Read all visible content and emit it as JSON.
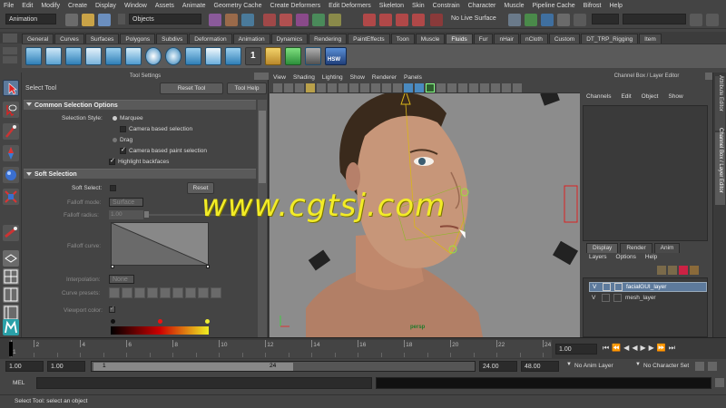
{
  "menubar": [
    "File",
    "Edit",
    "Modify",
    "Create",
    "Display",
    "Window",
    "Assets",
    "Animate",
    "Geometry Cache",
    "Create Deformers",
    "Edit Deformers",
    "Skeleton",
    "Skin",
    "Constrain",
    "Character",
    "Muscle",
    "Pipeline Cache",
    "Bifrost",
    "Help"
  ],
  "statusline": {
    "mode": "Animation",
    "objects": "Objects",
    "live": "No Live Surface"
  },
  "shelf_tabs": [
    "General",
    "Curves",
    "Surfaces",
    "Polygons",
    "Subdivs",
    "Deformation",
    "Animation",
    "Dynamics",
    "Rendering",
    "PaintEffects",
    "Toon",
    "Muscle",
    "Fluids",
    "Fur",
    "nHair",
    "nCloth",
    "Custom",
    "DT_TRP_Rigging",
    "Item"
  ],
  "shelf_active": "Fluids",
  "shelf_hsw": "HSW",
  "shelf_one": "1",
  "tool_settings": {
    "header": "Tool Settings",
    "title": "Select Tool",
    "reset_tool": "Reset Tool",
    "tool_help": "Tool Help",
    "sec_common": "Common Selection Options",
    "selection_style": "Selection Style:",
    "marquee": "Marquee",
    "camera_based_selection": "Camera based selection",
    "drag": "Drag",
    "camera_based_paint": "Camera based paint selection",
    "highlight_backfaces": "Highlight backfaces",
    "sec_soft": "Soft Selection",
    "soft_select": "Soft Select:",
    "reset": "Reset",
    "falloff_mode": "Falloff mode:",
    "falloff_mode_val": "Surface",
    "falloff_radius": "Falloff radius:",
    "falloff_radius_val": "1.00",
    "falloff_curve": "Falloff curve:",
    "interpolation": "Interpolation:",
    "interpolation_val": "None",
    "curve_presets": "Curve presets:",
    "viewport_color": "Viewport color:"
  },
  "viewport": {
    "menu": [
      "View",
      "Shading",
      "Lighting",
      "Show",
      "Renderer",
      "Panels"
    ],
    "camera": "persp",
    "watermark": "www.cgtsj.com"
  },
  "channel_box": {
    "title": "Channel Box / Layer Editor",
    "menu": [
      "Channels",
      "Edit",
      "Object",
      "Show"
    ],
    "side_tab1": "Attribute Editor",
    "side_tab2": "Channel Box / Layer Editor",
    "layer_tabs": [
      "Display",
      "Render",
      "Anim"
    ],
    "layer_menu": [
      "Layers",
      "Options",
      "Help"
    ],
    "layers": [
      {
        "v": "V",
        "name": "facialGUI_layer"
      },
      {
        "v": "V",
        "name": "mesh_layer"
      }
    ]
  },
  "timeline": {
    "ticks": [
      "1",
      "2",
      "4",
      "6",
      "8",
      "10",
      "12",
      "14",
      "16",
      "18",
      "20",
      "22",
      "24"
    ],
    "current": "1.00"
  },
  "range": {
    "start": "1.00",
    "inner_start": "1.00",
    "slider_start": "1",
    "slider_end": "24",
    "inner_end": "24.00",
    "end": "48.00",
    "anim_layer": "No Anim Layer",
    "char_set": "No Character Set"
  },
  "cmd": {
    "label": "MEL"
  },
  "help_line": "Select Tool: select an object",
  "colors": {
    "accent": "#5d7a9c",
    "watermark": "#f3ec27"
  }
}
